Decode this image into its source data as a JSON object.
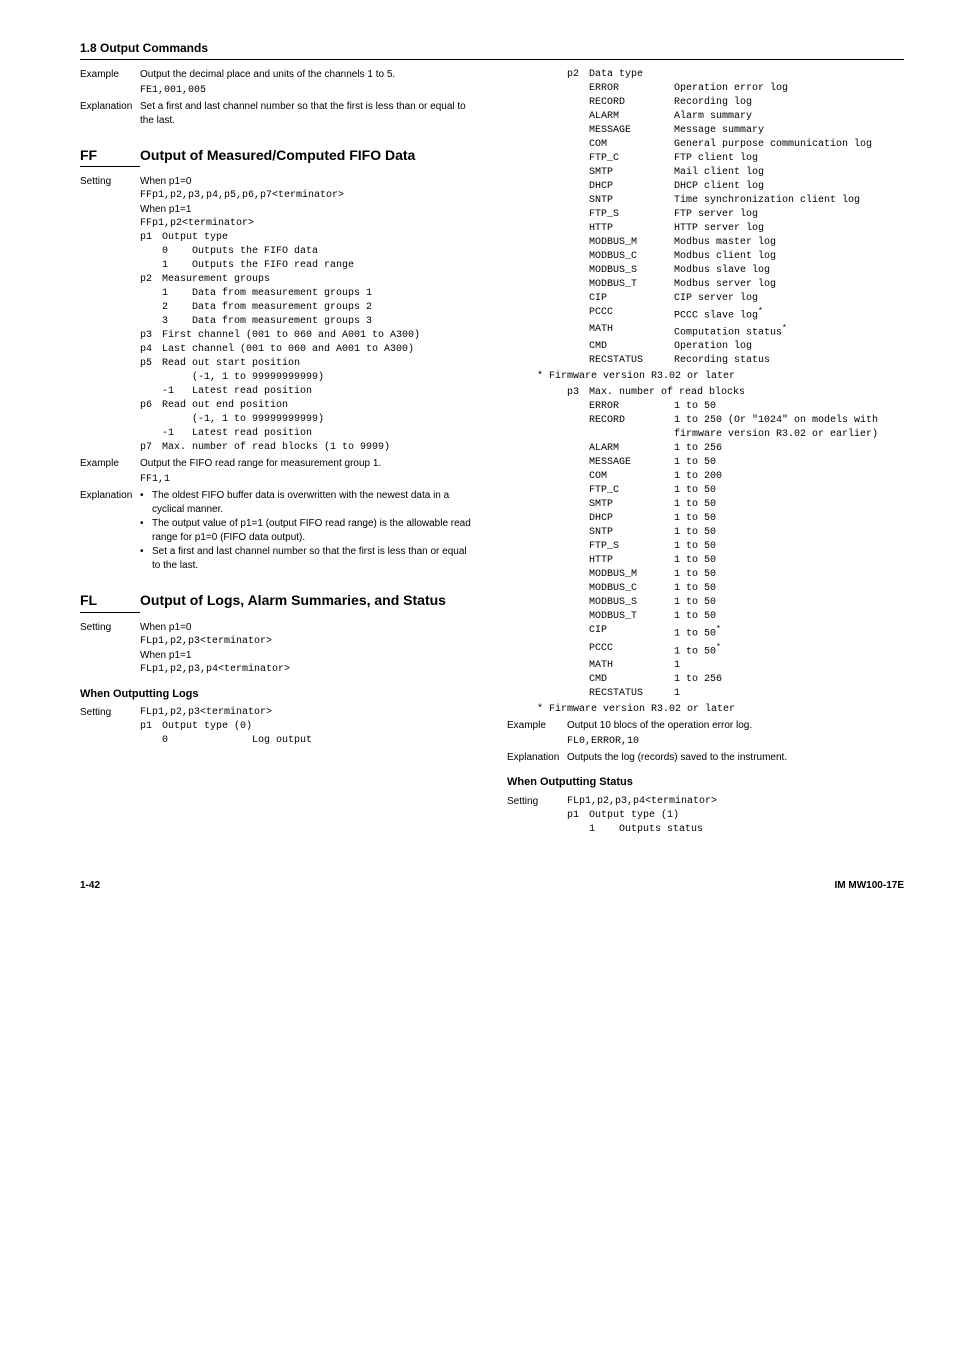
{
  "section_title": "1.8  Output Commands",
  "left": {
    "entry1": {
      "example_label": "Example",
      "example_text": "Output the decimal place and units of the channels 1 to 5.",
      "example_code": "FE1,001,005",
      "expl_label": "Explanation",
      "expl_text": "Set a first and last channel number so that the first is less than or equal to the last."
    },
    "ff": {
      "code": "FF",
      "title": "Output of Measured/Computed FIFO Data",
      "setting_label": "Setting",
      "when0": "When p1=0",
      "when0_code": "FFp1,p2,p3,p4,p5,p6,p7<terminator>",
      "when1": "When p1=1",
      "when1_code": "FFp1,p2<terminator>",
      "p1_label": "p1",
      "p1_desc": "Output type",
      "p1_v0k": "0",
      "p1_v0d": "Outputs the FIFO data",
      "p1_v1k": "1",
      "p1_v1d": "Outputs the FIFO read range",
      "p2_label": "p2",
      "p2_desc": "Measurement groups",
      "p2_v1k": "1",
      "p2_v1d": "Data from measurement groups 1",
      "p2_v2k": "2",
      "p2_v2d": "Data from measurement groups 2",
      "p2_v3k": "3",
      "p2_v3d": "Data from measurement groups 3",
      "p3_label": "p3",
      "p3_desc": "First channel (001 to 060 and A001 to A300)",
      "p4_label": "p4",
      "p4_desc": "Last channel (001 to 060 and A001 to A300)",
      "p5_label": "p5",
      "p5_desc": "Read out start position",
      "p5_v1k": "",
      "p5_v1d": "(-1, 1 to 99999999999)",
      "p5_v2k": "-1",
      "p5_v2d": "Latest read position",
      "p6_label": "p6",
      "p6_desc": "Read out end position",
      "p6_v1k": "",
      "p6_v1d": "(-1, 1 to 99999999999)",
      "p6_v2k": "-1",
      "p6_v2d": "Latest read position",
      "p7_label": "p7",
      "p7_desc": "Max. number of read blocks (1 to 9999)",
      "example_label": "Example",
      "example_text": "Output the FIFO read range for measurement group 1.",
      "example_code": "FF1,1",
      "expl_label": "Explanation",
      "expl_b1": "The oldest FIFO buffer data is overwritten with the newest data in a cyclical manner.",
      "expl_b2": "The output value of p1=1 (output FIFO read range) is the allowable read range for p1=0 (FIFO data output).",
      "expl_b3": "Set a first and last channel number so that the first is less than or equal to the last."
    },
    "fl": {
      "code": "FL",
      "title": "Output of Logs, Alarm Summaries, and Status",
      "setting_label": "Setting",
      "when0": "When p1=0",
      "when0_code": "FLp1,p2,p3<terminator>",
      "when1": "When p1=1",
      "when1_code": "FLp1,p2,p3,p4<terminator>",
      "sub_title": "When Outputting Logs",
      "setting2_label": "Setting",
      "setting2_code": "FLp1,p2,p3<terminator>",
      "p1_label": "p1",
      "p1_desc": "Output type (0)",
      "p1_v0k": "0",
      "p1_v0d": "Log output"
    }
  },
  "right": {
    "p2_label": "p2",
    "p2_desc": "Data type",
    "kv": [
      {
        "k": "ERROR",
        "v": "Operation error log"
      },
      {
        "k": "RECORD",
        "v": "Recording log"
      },
      {
        "k": "ALARM",
        "v": "Alarm summary"
      },
      {
        "k": "MESSAGE",
        "v": "Message summary"
      },
      {
        "k": "COM",
        "v": "General purpose communication log"
      },
      {
        "k": "FTP_C",
        "v": "FTP client log"
      },
      {
        "k": "SMTP",
        "v": "Mail client log"
      },
      {
        "k": "DHCP",
        "v": "DHCP client log"
      },
      {
        "k": "SNTP",
        "v": "Time synchronization client log"
      },
      {
        "k": "FTP_S",
        "v": "FTP server log"
      },
      {
        "k": "HTTP",
        "v": "HTTP server log"
      },
      {
        "k": "MODBUS_M",
        "v": "Modbus master log"
      },
      {
        "k": "MODBUS_C",
        "v": "Modbus client log"
      },
      {
        "k": "MODBUS_S",
        "v": "Modbus slave log"
      },
      {
        "k": "MODBUS_T",
        "v": "Modbus server log"
      },
      {
        "k": "CIP",
        "v": "CIP server log"
      }
    ],
    "pccc_k": "PCCC",
    "pccc_v": "PCCC slave log",
    "math_k": "MATH",
    "math_v": "Computation status",
    "kv2": [
      {
        "k": "CMD",
        "v": "Operation log"
      },
      {
        "k": "RECSTATUS",
        "v": "Recording status"
      }
    ],
    "footnote1": "* Firmware version R3.02 or later",
    "p3_label": "p3",
    "p3_desc": "Max. number of read blocks",
    "p3_kv": [
      {
        "k": "ERROR",
        "v": "1 to 50"
      }
    ],
    "p3_record_k": "RECORD",
    "p3_record_v": "1 to 250 (Or \"1024\" on models with firmware version R3.02 or earlier)",
    "p3_kv2": [
      {
        "k": "ALARM",
        "v": "1 to 256"
      },
      {
        "k": "MESSAGE",
        "v": "1 to 50"
      },
      {
        "k": "COM",
        "v": "1 to 200"
      },
      {
        "k": "FTP_C",
        "v": "1 to 50"
      },
      {
        "k": "SMTP",
        "v": "1 to 50"
      },
      {
        "k": "DHCP",
        "v": "1 to 50"
      },
      {
        "k": "SNTP",
        "v": "1 to 50"
      },
      {
        "k": "FTP_S",
        "v": "1 to 50"
      },
      {
        "k": "HTTP",
        "v": "1 to 50"
      },
      {
        "k": "MODBUS_M",
        "v": "1 to 50"
      },
      {
        "k": "MODBUS_C",
        "v": "1 to 50"
      },
      {
        "k": "MODBUS_S",
        "v": "1 to 50"
      },
      {
        "k": "MODBUS_T",
        "v": "1 to 50"
      }
    ],
    "cip_k": "CIP",
    "cip_v": "1 to 50",
    "pccc2_k": "PCCC",
    "pccc2_v": "1 to 50",
    "p3_kv3": [
      {
        "k": "MATH",
        "v": "1"
      },
      {
        "k": "CMD",
        "v": "1 to 256"
      },
      {
        "k": "RECSTATUS",
        "v": "1"
      }
    ],
    "footnote2": "* Firmware version R3.02 or later",
    "example_label": "Example",
    "example_text": "Output 10 blocs of the operation error log.",
    "example_code": "FL0,ERROR,10",
    "expl_label": "Explanation",
    "expl_text": "Outputs the log (records) saved to the instrument.",
    "sub_title2": "When Outputting Status",
    "setting3_label": "Setting",
    "setting3_code": "FLp1,p2,p3,p4<terminator>",
    "st_p1_label": "p1",
    "st_p1_desc": "Output type (1)",
    "st_p1_v1k": "1",
    "st_p1_v1d": "Outputs status"
  },
  "footer": {
    "page": "1-42",
    "doc": "IM MW100-17E"
  }
}
